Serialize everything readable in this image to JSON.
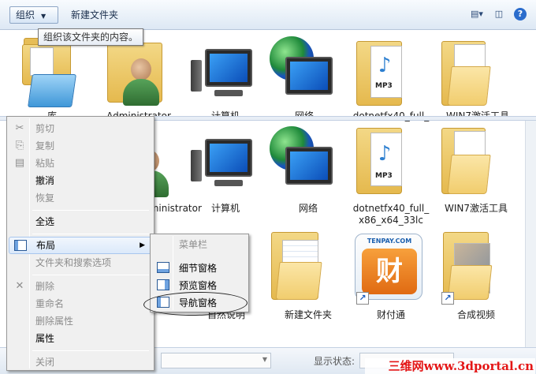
{
  "toolbar": {
    "organize_label": "组织",
    "organize_arrow": "▼",
    "new_folder_label": "新建文件夹",
    "view_icon": "view-options-icon",
    "preview_icon": "preview-pane-icon",
    "help_icon": "help-icon",
    "help_glyph": "?"
  },
  "tooltip": {
    "text": "组织该文件夹的内容。"
  },
  "top_row": {
    "items": [
      {
        "label": "库",
        "icon": "libraries-folder-icon"
      },
      {
        "label": "Administrator",
        "icon": "user-folder-icon"
      },
      {
        "label": "计算机",
        "icon": "computer-icon"
      },
      {
        "label": "网络",
        "icon": "network-icon"
      },
      {
        "label": "dotnetfx40_full_",
        "icon": "mp3-folder-icon"
      },
      {
        "label": "WIN7激活工具",
        "icon": "folder-icon"
      }
    ]
  },
  "main_row1": {
    "items": [
      {
        "label": "Administrator",
        "icon": "user-folder-icon"
      },
      {
        "label": "计算机",
        "icon": "computer-icon"
      },
      {
        "label": "网络",
        "icon": "network-icon"
      },
      {
        "label": "dotnetfx40_full_\nx86_x64_33lc",
        "line1": "dotnetfx40_full_",
        "line2": "x86_x64_33lc",
        "icon": "mp3-folder-icon"
      },
      {
        "label": "WIN7激活工具",
        "icon": "folder-icon"
      }
    ]
  },
  "main_row2": {
    "items": [
      {
        "label": "自然说明",
        "icon": "folder-icon"
      },
      {
        "label": "新建文件夹",
        "icon": "folder-icon"
      },
      {
        "label": "财付通",
        "icon": "tenpay-shortcut-icon",
        "brand": "TENPAY.COM",
        "glyph": "财"
      },
      {
        "label": "合成视频",
        "icon": "folder-shortcut-icon"
      }
    ]
  },
  "context_menu": {
    "items": [
      {
        "label": "剪切",
        "disabled": true,
        "icon": "scissors-icon",
        "glyph": "✂"
      },
      {
        "label": "复制",
        "disabled": true,
        "icon": "copy-icon",
        "glyph": "⎘"
      },
      {
        "label": "粘贴",
        "disabled": true,
        "icon": "paste-icon",
        "glyph": "📋"
      },
      {
        "label": "撤消",
        "disabled": false
      },
      {
        "label": "恢复",
        "disabled": true
      },
      {
        "label": "全选",
        "disabled": false
      },
      {
        "label": "布局",
        "disabled": false,
        "highlighted": true,
        "icon": "layout-icon",
        "submenu_arrow": "▶"
      },
      {
        "label": "文件夹和搜索选项",
        "disabled": true
      },
      {
        "label": "删除",
        "disabled": true,
        "icon": "delete-icon",
        "glyph": "✕"
      },
      {
        "label": "重命名",
        "disabled": true
      },
      {
        "label": "删除属性",
        "disabled": true
      },
      {
        "label": "属性",
        "disabled": false
      },
      {
        "label": "关闭",
        "disabled": true
      }
    ]
  },
  "layout_submenu": {
    "items": [
      {
        "label": "菜单栏",
        "disabled": true
      },
      {
        "label": "细节窗格",
        "disabled": false,
        "icon": "details-pane-icon"
      },
      {
        "label": "预览窗格",
        "disabled": false,
        "icon": "preview-pane-icon"
      },
      {
        "label": "导航窗格",
        "disabled": false,
        "icon": "navigation-pane-icon",
        "circled": true
      }
    ]
  },
  "statusbar": {
    "state_label": "显示状态:"
  },
  "watermark": {
    "text": "三维网www.3dportal.cn"
  },
  "colors": {
    "toolbar_top": "#f8fbfe",
    "toolbar_bottom": "#dde8f4",
    "menu_bg": "#f0f0f0",
    "highlight_border": "#a8c6ee",
    "watermark": "#e41616"
  }
}
